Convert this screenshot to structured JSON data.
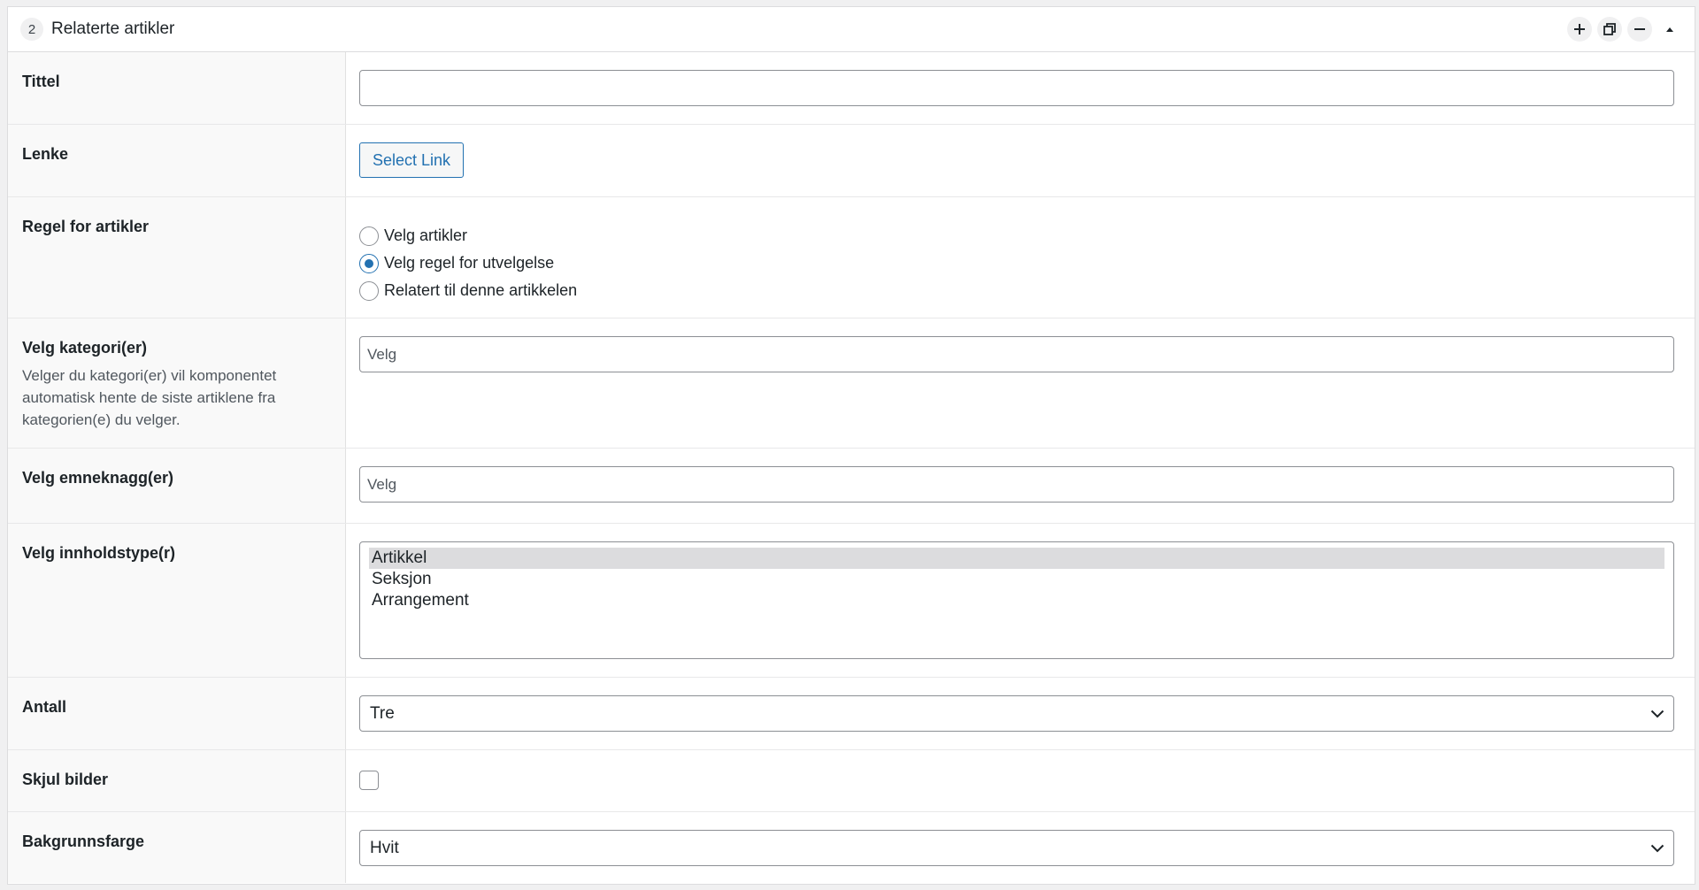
{
  "panel": {
    "order": "2",
    "title": "Relaterte artikler",
    "actions": [
      "plus-icon",
      "duplicate-icon",
      "minus-icon",
      "collapse-icon"
    ]
  },
  "fields": {
    "tittel": {
      "label": "Tittel",
      "value": ""
    },
    "lenke": {
      "label": "Lenke",
      "button": "Select Link"
    },
    "regel": {
      "label": "Regel for artikler",
      "options": [
        "Velg artikler",
        "Velg regel for utvelgelse",
        "Relatert til denne artikkelen"
      ],
      "selected": "Velg regel for utvelgelse"
    },
    "kategori": {
      "label": "Velg kategori(er)",
      "description": "Velger du kategori(er) vil komponentet automatisk hente de siste artiklene fra kategorien(e) du velger.",
      "placeholder": "Velg"
    },
    "emneknagg": {
      "label": "Velg emneknagg(er)",
      "placeholder": "Velg"
    },
    "innholdstype": {
      "label": "Velg innholdstype(r)",
      "options": [
        "Artikkel",
        "Seksjon",
        "Arrangement"
      ],
      "selected": "Artikkel"
    },
    "antall": {
      "label": "Antall",
      "value": "Tre"
    },
    "skjul": {
      "label": "Skjul bilder",
      "checked": false
    },
    "bakgrunn": {
      "label": "Bakgrunnsfarge",
      "value": "Hvit"
    }
  },
  "colors": {
    "accent": "#2271b1",
    "border": "#8c8f94",
    "label_bg": "#f9f9f9"
  }
}
